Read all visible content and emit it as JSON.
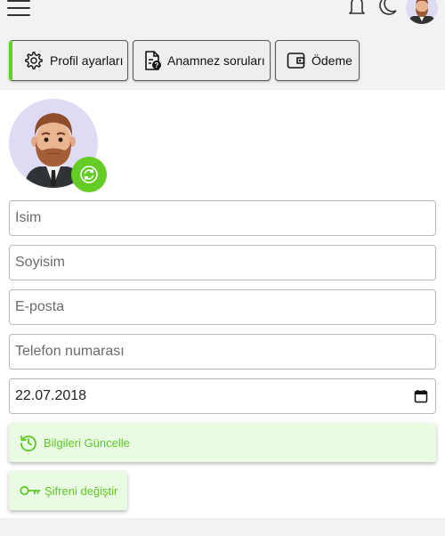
{
  "header": {
    "menu_icon": "hamburger-menu-icon",
    "notification_icon": "bell-icon",
    "theme_icon": "moon-icon",
    "avatar_icon": "user-avatar"
  },
  "tabs": [
    {
      "label": "Profil ayarları",
      "icon": "gear-icon",
      "active": true
    },
    {
      "label": "Anamnez soruları",
      "icon": "document-question-icon",
      "active": false
    },
    {
      "label": "Ödeme",
      "icon": "wallet-icon",
      "active": false
    }
  ],
  "form": {
    "name_placeholder": "İsim",
    "name_value": "",
    "surname_placeholder": "Soyisim",
    "surname_value": "",
    "email_placeholder": "E-posta",
    "email_value": "",
    "phone_placeholder": "Telefon numarası",
    "phone_value": "",
    "birth_date": "22.07.2018"
  },
  "buttons": {
    "update_label": "Bilgileri Güncelle",
    "change_password_label": "Şifreni değiştir"
  },
  "colors": {
    "accent_green": "#63cd26",
    "button_text_green": "#5fc728",
    "button_bg": "#eafbe3",
    "avatar_bg": "#dedcf5",
    "page_bg": "#f2f2f4"
  }
}
